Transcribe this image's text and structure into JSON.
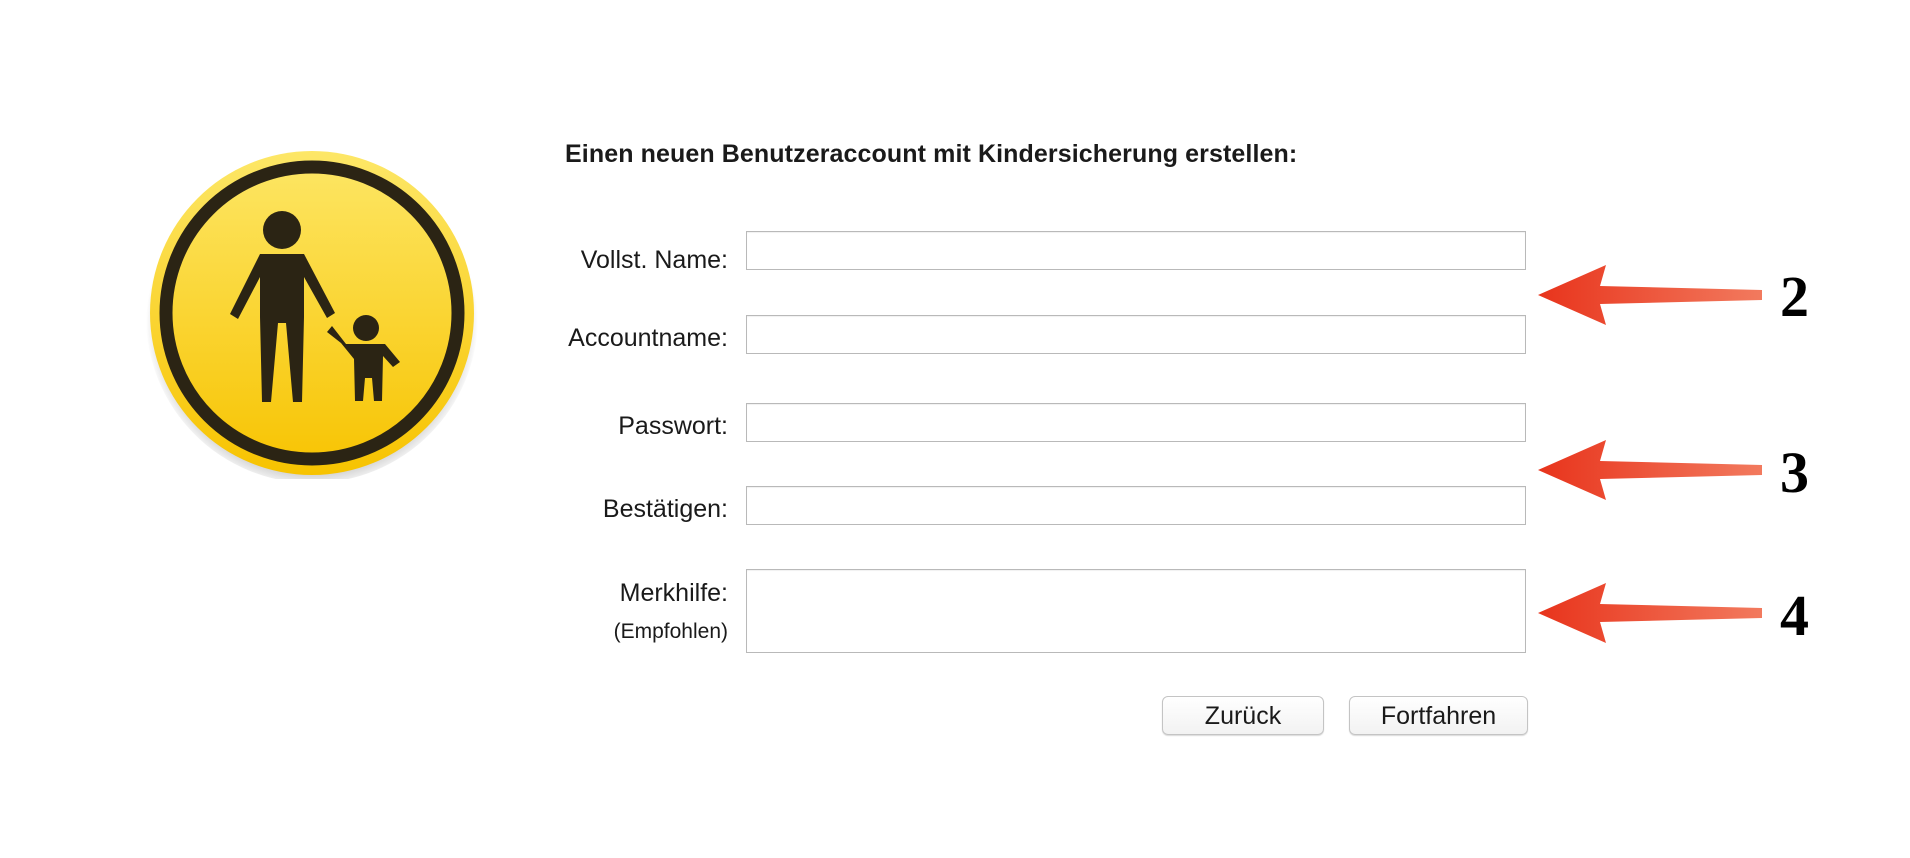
{
  "dialog": {
    "heading": "Einen neuen Benutzeraccount mit Kindersicherung erstellen:",
    "icon": "parental-controls-icon",
    "fields": {
      "full_name": {
        "label": "Vollst. Name:",
        "value": ""
      },
      "account_name": {
        "label": "Accountname:",
        "value": ""
      },
      "password": {
        "label": "Passwort:",
        "value": ""
      },
      "confirm": {
        "label": "Bestätigen:",
        "value": ""
      },
      "hint": {
        "label": "Merkhilfe:",
        "sublabel": "(Empfohlen)",
        "value": ""
      }
    },
    "buttons": {
      "back": "Zurück",
      "continue": "Fortfahren"
    }
  },
  "annotations": {
    "arrow_color": "#e8341c",
    "markers": [
      "2",
      "3",
      "4"
    ]
  },
  "colors": {
    "icon_yellow_top": "#fde35a",
    "icon_yellow_bottom": "#f9c400",
    "icon_dark": "#2b2414"
  }
}
